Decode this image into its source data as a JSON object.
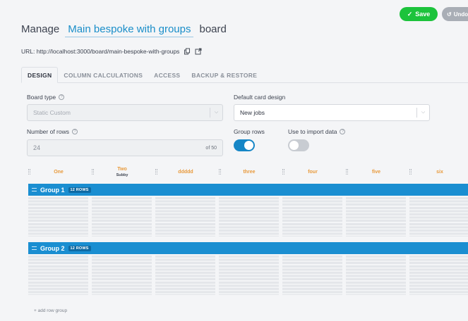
{
  "toolbar": {
    "save_label": "Save",
    "undo_label": "Undo"
  },
  "header": {
    "title_prefix": "Manage",
    "board_name": "Main bespoke with groups",
    "title_suffix": "board"
  },
  "url": {
    "text": "URL: http://localhost:3000/board/main-bespoke-with-groups"
  },
  "tabs": [
    {
      "label": "DESIGN",
      "active": true
    },
    {
      "label": "COLUMN CALCULATIONS",
      "active": false
    },
    {
      "label": "ACCESS",
      "active": false
    },
    {
      "label": "BACKUP & RESTORE",
      "active": false
    }
  ],
  "form": {
    "board_type_label": "Board type",
    "board_type_value": "Static Custom",
    "default_card_label": "Default card design",
    "default_card_value": "New jobs",
    "num_rows_label": "Number of rows",
    "num_rows_value": "24",
    "num_rows_max": "of 50",
    "group_rows_label": "Group rows",
    "group_rows_on": true,
    "import_label": "Use to import data",
    "import_on": false
  },
  "columns": [
    {
      "name": "One",
      "sub": ""
    },
    {
      "name": "Two",
      "sub": "Subby"
    },
    {
      "name": "ddddd",
      "sub": ""
    },
    {
      "name": "three",
      "sub": ""
    },
    {
      "name": "four",
      "sub": ""
    },
    {
      "name": "five",
      "sub": ""
    },
    {
      "name": "six",
      "sub": ""
    }
  ],
  "groups": [
    {
      "name": "Group 1",
      "badge": "12 ROWS"
    },
    {
      "name": "Group 2",
      "badge": "12 ROWS"
    }
  ],
  "add_group_label": "+ add row group",
  "colors": {
    "accent": "#1a8ed1",
    "save": "#1cc33c",
    "column_header": "#e89a3c"
  }
}
